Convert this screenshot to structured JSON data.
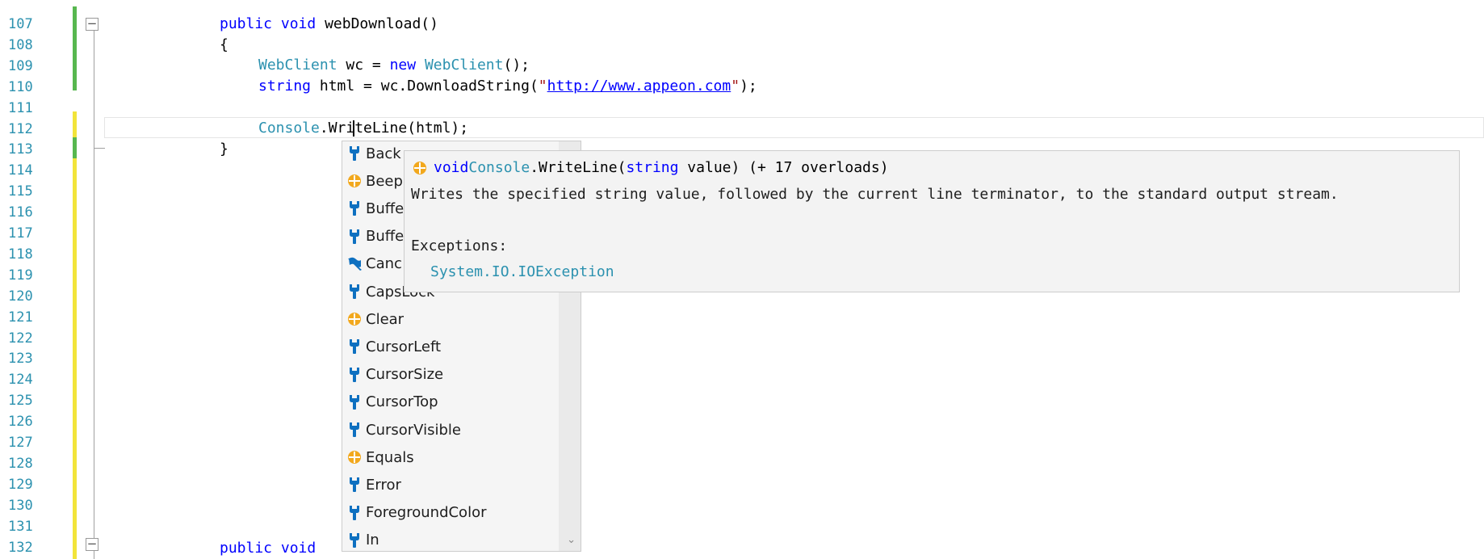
{
  "editor": {
    "line_numbers": [
      "107",
      "108",
      "109",
      "110",
      "111",
      "112",
      "113",
      "114",
      "115",
      "116",
      "117",
      "118",
      "119",
      "120",
      "121",
      "122",
      "123",
      "124",
      "125",
      "126",
      "127",
      "128",
      "129",
      "130",
      "131",
      "132"
    ],
    "code": {
      "l107_kw1": "public",
      "l107_kw2": "void",
      "l107_name": " webDownload()",
      "l108": "{",
      "l109_type1": "WebClient",
      "l109_mid": " wc = ",
      "l109_kw": "new",
      "l109_type2": "WebClient",
      "l109_end": "();",
      "l110_kw": "string",
      "l110_mid": " html = wc.DownloadString(",
      "l110_q1": "\"",
      "l110_url": "http://www.appeon.com",
      "l110_q2": "\"",
      "l110_end": ");",
      "l112_type": "Console",
      "l112_rest": ".WriteLine(html);",
      "l113": "}",
      "l132_kw1": "public",
      "l132_kw2": "void"
    }
  },
  "completion_list": {
    "items": [
      {
        "label": "Back",
        "icon": "property-wrench-icon"
      },
      {
        "label": "Beep",
        "icon": "method-cube-icon"
      },
      {
        "label": "Buffe",
        "icon": "property-wrench-icon"
      },
      {
        "label": "Buffe",
        "icon": "property-wrench-icon"
      },
      {
        "label": "Canc",
        "icon": "event-flag-icon"
      },
      {
        "label": "CapsLock",
        "icon": "property-wrench-icon"
      },
      {
        "label": "Clear",
        "icon": "method-cube-icon"
      },
      {
        "label": "CursorLeft",
        "icon": "property-wrench-icon"
      },
      {
        "label": "CursorSize",
        "icon": "property-wrench-icon"
      },
      {
        "label": "CursorTop",
        "icon": "property-wrench-icon"
      },
      {
        "label": "CursorVisible",
        "icon": "property-wrench-icon"
      },
      {
        "label": "Equals",
        "icon": "method-cube-icon"
      },
      {
        "label": "Error",
        "icon": "property-wrench-icon"
      },
      {
        "label": "ForegroundColor",
        "icon": "property-wrench-icon"
      },
      {
        "label": "In",
        "icon": "property-wrench-icon"
      }
    ]
  },
  "quick_info": {
    "sig_kw": "void",
    "sig_type": "Console",
    "sig_method": ".WriteLine(",
    "sig_param_type": "string",
    "sig_rest": " value) (+ 17 overloads)",
    "description": "Writes the specified string value, followed by the current line terminator, to the standard output stream.",
    "exceptions_label": "Exceptions:",
    "exception": "System.IO.IOException"
  },
  "colors": {
    "line_number": "#2b91af",
    "keyword": "#0000ff",
    "type": "#2b91af",
    "string": "#a31515",
    "saved_change": "#57b74f",
    "unsaved_change": "#f2e43a"
  }
}
